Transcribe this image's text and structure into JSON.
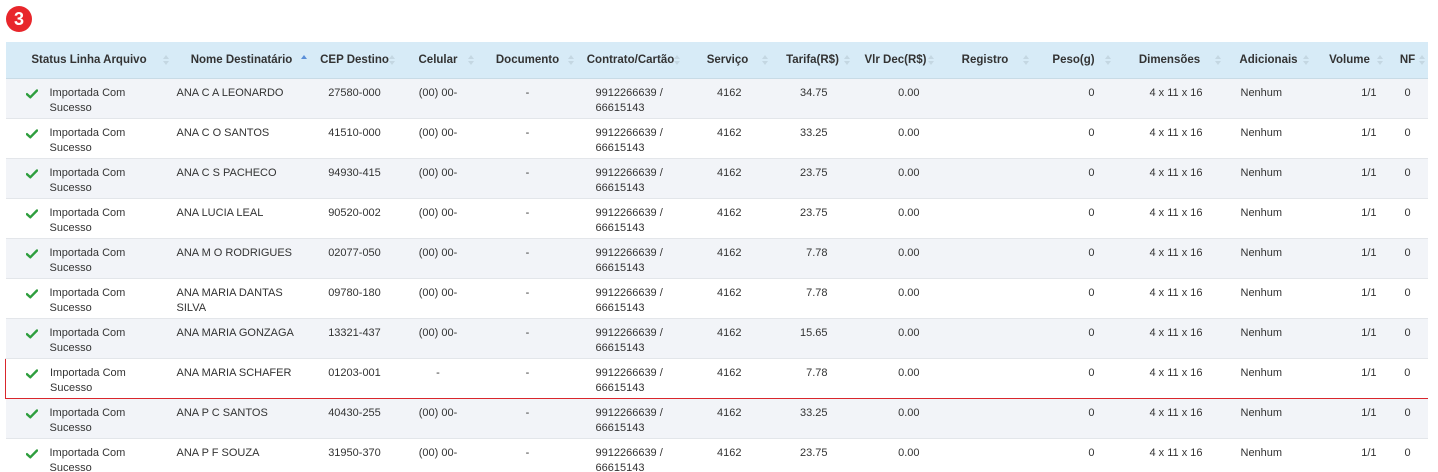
{
  "step_badge": "3",
  "columns": [
    {
      "label": "Status Linha Arquivo",
      "sorted": false
    },
    {
      "label": "Nome Destinatário",
      "sorted": true
    },
    {
      "label": "CEP Destino",
      "sorted": false
    },
    {
      "label": "Celular",
      "sorted": false
    },
    {
      "label": "Documento",
      "sorted": false
    },
    {
      "label": "Contrato/Cartão",
      "sorted": false
    },
    {
      "label": "Serviço",
      "sorted": false
    },
    {
      "label": "Tarifa(R$)",
      "sorted": false
    },
    {
      "label": "Vlr Dec(R$)",
      "sorted": false
    },
    {
      "label": "Registro",
      "sorted": false
    },
    {
      "label": "Peso(g)",
      "sorted": false
    },
    {
      "label": "Dimensões",
      "sorted": false
    },
    {
      "label": "Adicionais",
      "sorted": false
    },
    {
      "label": "Volume",
      "sorted": false
    },
    {
      "label": "NF",
      "sorted": false
    }
  ],
  "colors": {
    "header_bg": "#d7ebf7",
    "check_green": "#2e9e3e",
    "highlight_border": "#d9262c",
    "badge_red": "#e8262b"
  },
  "rows": [
    {
      "status": "Importada Com Sucesso",
      "nome": "ANA C A LEONARDO",
      "cep": "27580-000",
      "celular": "(00) 00-",
      "documento": "-",
      "contrato": "9912266639 /",
      "cartao": "66615143",
      "servico": "4162",
      "tarifa": "34.75",
      "vlr_dec": "0.00",
      "registro": "",
      "peso": "0",
      "dimensoes": "4 x 11 x 16",
      "adicionais": "Nenhum",
      "volume": "1/1",
      "nf": "0",
      "highlighted": false
    },
    {
      "status": "Importada Com Sucesso",
      "nome": "ANA C O SANTOS",
      "cep": "41510-000",
      "celular": "(00) 00-",
      "documento": "-",
      "contrato": "9912266639 /",
      "cartao": "66615143",
      "servico": "4162",
      "tarifa": "33.25",
      "vlr_dec": "0.00",
      "registro": "",
      "peso": "0",
      "dimensoes": "4 x 11 x 16",
      "adicionais": "Nenhum",
      "volume": "1/1",
      "nf": "0",
      "highlighted": false
    },
    {
      "status": "Importada Com Sucesso",
      "nome": "ANA C S PACHECO",
      "cep": "94930-415",
      "celular": "(00) 00-",
      "documento": "-",
      "contrato": "9912266639 /",
      "cartao": "66615143",
      "servico": "4162",
      "tarifa": "23.75",
      "vlr_dec": "0.00",
      "registro": "",
      "peso": "0",
      "dimensoes": "4 x 11 x 16",
      "adicionais": "Nenhum",
      "volume": "1/1",
      "nf": "0",
      "highlighted": false
    },
    {
      "status": "Importada Com Sucesso",
      "nome": "ANA LUCIA LEAL",
      "cep": "90520-002",
      "celular": "(00) 00-",
      "documento": "-",
      "contrato": "9912266639 /",
      "cartao": "66615143",
      "servico": "4162",
      "tarifa": "23.75",
      "vlr_dec": "0.00",
      "registro": "",
      "peso": "0",
      "dimensoes": "4 x 11 x 16",
      "adicionais": "Nenhum",
      "volume": "1/1",
      "nf": "0",
      "highlighted": false
    },
    {
      "status": "Importada Com Sucesso",
      "nome": "ANA M O RODRIGUES",
      "cep": "02077-050",
      "celular": "(00) 00-",
      "documento": "-",
      "contrato": "9912266639 /",
      "cartao": "66615143",
      "servico": "4162",
      "tarifa": "7.78",
      "vlr_dec": "0.00",
      "registro": "",
      "peso": "0",
      "dimensoes": "4 x 11 x 16",
      "adicionais": "Nenhum",
      "volume": "1/1",
      "nf": "0",
      "highlighted": false
    },
    {
      "status": "Importada Com Sucesso",
      "nome": "ANA MARIA DANTAS SILVA",
      "cep": "09780-180",
      "celular": "(00) 00-",
      "documento": "-",
      "contrato": "9912266639 /",
      "cartao": "66615143",
      "servico": "4162",
      "tarifa": "7.78",
      "vlr_dec": "0.00",
      "registro": "",
      "peso": "0",
      "dimensoes": "4 x 11 x 16",
      "adicionais": "Nenhum",
      "volume": "1/1",
      "nf": "0",
      "highlighted": false
    },
    {
      "status": "Importada Com Sucesso",
      "nome": "ANA MARIA GONZAGA",
      "cep": "13321-437",
      "celular": "(00) 00-",
      "documento": "-",
      "contrato": "9912266639 /",
      "cartao": "66615143",
      "servico": "4162",
      "tarifa": "15.65",
      "vlr_dec": "0.00",
      "registro": "",
      "peso": "0",
      "dimensoes": "4 x 11 x 16",
      "adicionais": "Nenhum",
      "volume": "1/1",
      "nf": "0",
      "highlighted": false
    },
    {
      "status": "Importada Com Sucesso",
      "nome": "ANA MARIA SCHAFER",
      "cep": "01203-001",
      "celular": "-",
      "documento": "-",
      "contrato": "9912266639 /",
      "cartao": "66615143",
      "servico": "4162",
      "tarifa": "7.78",
      "vlr_dec": "0.00",
      "registro": "",
      "peso": "0",
      "dimensoes": "4 x 11 x 16",
      "adicionais": "Nenhum",
      "volume": "1/1",
      "nf": "0",
      "highlighted": true
    },
    {
      "status": "Importada Com Sucesso",
      "nome": "ANA P C SANTOS",
      "cep": "40430-255",
      "celular": "(00) 00-",
      "documento": "-",
      "contrato": "9912266639 /",
      "cartao": "66615143",
      "servico": "4162",
      "tarifa": "33.25",
      "vlr_dec": "0.00",
      "registro": "",
      "peso": "0",
      "dimensoes": "4 x 11 x 16",
      "adicionais": "Nenhum",
      "volume": "1/1",
      "nf": "0",
      "highlighted": false
    },
    {
      "status": "Importada Com Sucesso",
      "nome": "ANA P F SOUZA",
      "cep": "31950-370",
      "celular": "(00) 00-",
      "documento": "-",
      "contrato": "9912266639 /",
      "cartao": "66615143",
      "servico": "4162",
      "tarifa": "23.75",
      "vlr_dec": "0.00",
      "registro": "",
      "peso": "0",
      "dimensoes": "4 x 11 x 16",
      "adicionais": "Nenhum",
      "volume": "1/1",
      "nf": "0",
      "highlighted": false
    }
  ]
}
